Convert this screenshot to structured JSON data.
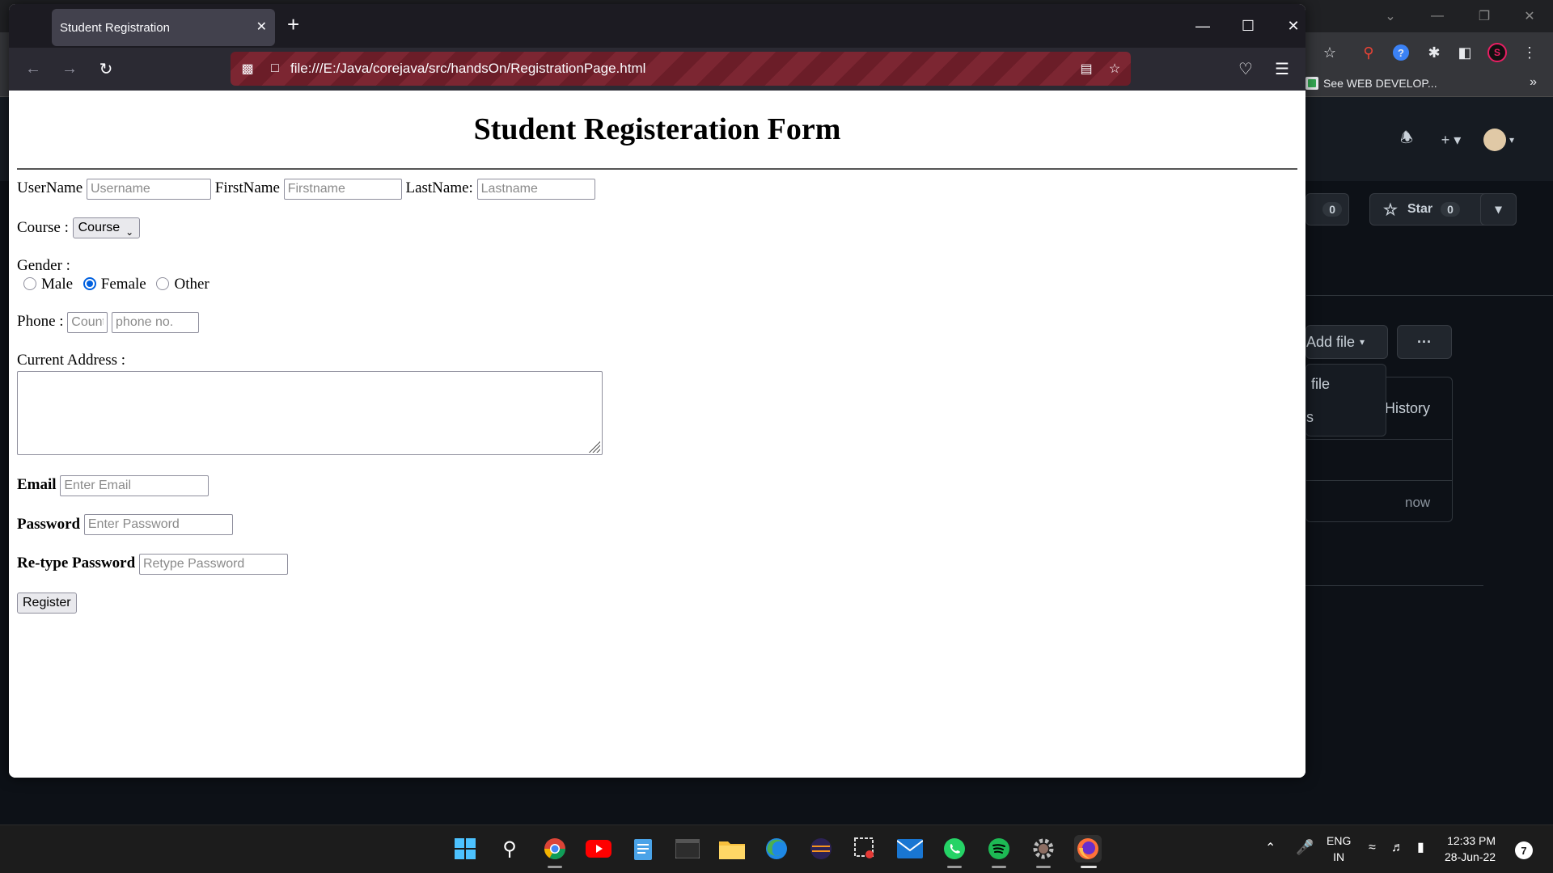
{
  "background_window": {
    "bookmark": "See WEB DEVELOP...",
    "bookmark_more": "»",
    "github": {
      "fork_count": "0",
      "star_label": "Star",
      "star_count": "0",
      "add_file_label": "Add file",
      "more_label": "···",
      "menu_item_1": "file",
      "menu_item_2": "s",
      "history_label": "History",
      "time_label": "now"
    }
  },
  "browser": {
    "tab_title": "Student Registration",
    "url": "file:///E:/Java/corejava/src/handsOn/RegistrationPage.html"
  },
  "form": {
    "title": "Student Registeration Form",
    "username_label": "UserName",
    "username_placeholder": "Username",
    "firstname_label": "FirstName",
    "firstname_placeholder": "Firstname",
    "lastname_label": "LastName:",
    "lastname_placeholder": "Lastname",
    "course_label": "Course :",
    "course_selected": "Course",
    "gender_label": "Gender :",
    "gender_options": [
      {
        "label": "Male",
        "checked": false
      },
      {
        "label": "Female",
        "checked": true
      },
      {
        "label": "Other",
        "checked": false
      }
    ],
    "phone_label": "Phone :",
    "country_placeholder": "Country code",
    "phone_placeholder": "phone no.",
    "address_label": "Current Address :",
    "email_label": "Email",
    "email_placeholder": "Enter Email",
    "password_label": "Password",
    "password_placeholder": "Enter Password",
    "retype_label": "Re-type Password",
    "retype_placeholder": "Retype Password",
    "register_label": "Register"
  },
  "taskbar": {
    "language": "ENG",
    "region": "IN",
    "time": "12:33 PM",
    "date": "28-Jun-22",
    "notification_count": "7"
  }
}
